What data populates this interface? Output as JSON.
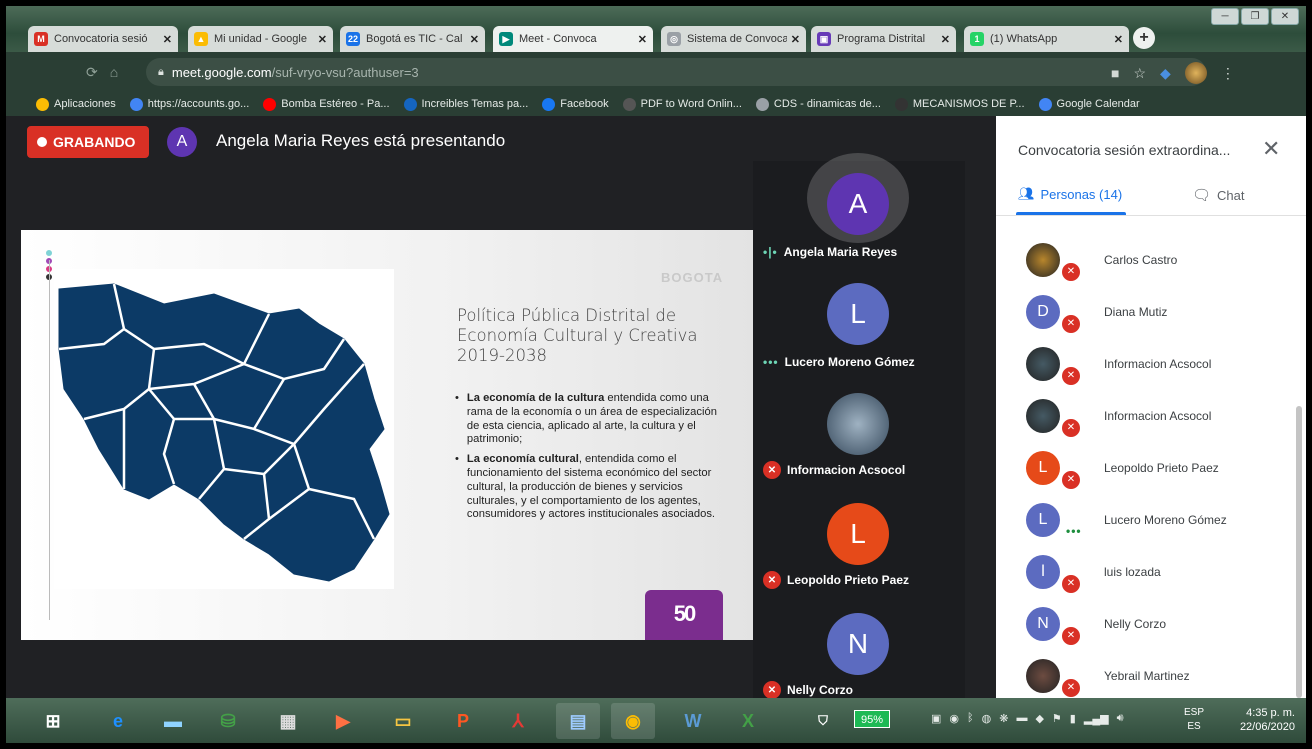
{
  "browser": {
    "tabs": [
      {
        "title": "Convocatoria sesió",
        "icon": "gmail-icon",
        "color": "#d93025",
        "glyph": "M"
      },
      {
        "title": "Mi unidad - Google",
        "icon": "drive-icon",
        "color": "#fbbc04",
        "glyph": "▲"
      },
      {
        "title": "Bogotá es TIC - Cal",
        "icon": "calendar-icon",
        "color": "#1a73e8",
        "glyph": "22"
      },
      {
        "title": "Meet - Convoca",
        "icon": "meet-icon",
        "color": "#00897b",
        "glyph": "▶"
      },
      {
        "title": "Sistema de Convoca",
        "icon": "globe-icon",
        "color": "#9aa0a6",
        "glyph": "◎"
      },
      {
        "title": "Programa Distrital",
        "icon": "program-icon",
        "color": "#673ab7",
        "glyph": "▣"
      },
      {
        "title": "(1) WhatsApp",
        "icon": "whatsapp-icon",
        "color": "#25d366",
        "glyph": "1"
      }
    ],
    "url_host": "meet.google.com",
    "url_path": "/suf-vryo-vsu?authuser=3",
    "bookmarks": [
      {
        "label": "Aplicaciones",
        "icon": "apps-icon",
        "color": "#fbbc04"
      },
      {
        "label": "https://accounts.go...",
        "icon": "google-icon",
        "color": "#4285f4"
      },
      {
        "label": "Bomba Estéreo - Pa...",
        "icon": "youtube-icon",
        "color": "#ff0000"
      },
      {
        "label": "Increibles Temas pa...",
        "icon": "t-icon",
        "color": "#1565c0"
      },
      {
        "label": "Facebook",
        "icon": "facebook-icon",
        "color": "#1877f2"
      },
      {
        "label": "PDF to Word Onlin...",
        "icon": "pdf-icon",
        "color": "#555555"
      },
      {
        "label": "CDS - dinamicas de...",
        "icon": "globe-icon",
        "color": "#9aa0a6"
      },
      {
        "label": "MECANISMOS DE P...",
        "icon": "mecanismos-icon",
        "color": "#333333"
      },
      {
        "label": "Google Calendar",
        "icon": "google-icon",
        "color": "#4285f4"
      }
    ]
  },
  "meet": {
    "recording_label": "GRABANDO",
    "presenter_initial": "A",
    "presenting_text": "Angela Maria Reyes está presentando",
    "slide": {
      "logo": "BOGOTA",
      "title_lines": [
        "Política Pública Distrital de",
        "Economía Cultural y Creativa",
        "2019-2038"
      ],
      "bullet1_bold": "La economía de la cultura",
      "bullet1_text": " entendida como una rama de la economía o un área de especialización de esta ciencia, aplicado al arte, la cultura y el patrimonio;",
      "bullet2_bold": "La economía cultural",
      "bullet2_text": ", entendida como el funcionamiento del sistema económico del sector cultural, la producción de bienes y servicios culturales, y el comportamiento de los agentes, consumidores y actores institucionales asociados.",
      "badge": "50"
    },
    "tiles": [
      {
        "initial": "A",
        "name": "Angela Maria Reyes",
        "color": "#5e35b1",
        "state": "speaking"
      },
      {
        "initial": "L",
        "name": "Lucero Moreno Gómez",
        "color": "#5c6bc0",
        "state": "dots"
      },
      {
        "initial": "",
        "name": "Informacion Acsocol",
        "color": "#607d8b",
        "state": "muted"
      },
      {
        "initial": "L",
        "name": "Leopoldo Prieto Paez",
        "color": "#e64a19",
        "state": "muted"
      },
      {
        "initial": "N",
        "name": "Nelly Corzo",
        "color": "#5c6bc0",
        "state": "muted"
      }
    ],
    "panel": {
      "title": "Convocatoria sesión extraordina...",
      "people_tab": "Personas (14)",
      "chat_tab": "Chat",
      "people": [
        {
          "name": "Carlos Castro",
          "initial": "",
          "color": "#b8862c",
          "state": "muted"
        },
        {
          "name": "Diana Mutiz",
          "initial": "D",
          "color": "#5c6bc0",
          "state": "muted"
        },
        {
          "name": "Informacion Acsocol",
          "initial": "",
          "color": "#455a64",
          "state": "muted"
        },
        {
          "name": "Informacion Acsocol",
          "initial": "",
          "color": "#455a64",
          "state": "muted"
        },
        {
          "name": "Leopoldo Prieto Paez",
          "initial": "L",
          "color": "#e64a19",
          "state": "muted"
        },
        {
          "name": "Lucero Moreno Gómez",
          "initial": "L",
          "color": "#5c6bc0",
          "state": "dots"
        },
        {
          "name": "luis lozada",
          "initial": "l",
          "color": "#5c6bc0",
          "state": "muted"
        },
        {
          "name": "Nelly Corzo",
          "initial": "N",
          "color": "#5c6bc0",
          "state": "muted"
        },
        {
          "name": "Yebrail Martinez",
          "initial": "",
          "color": "#6d4c41",
          "state": "muted"
        }
      ]
    }
  },
  "taskbar": {
    "battery": "95%",
    "lang_top": "ESP",
    "lang_bottom": "ES",
    "time": "4:35 p. m.",
    "date": "22/06/2020"
  }
}
